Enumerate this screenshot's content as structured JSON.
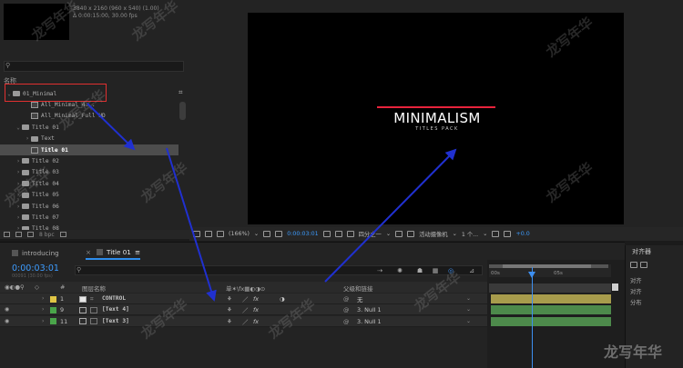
{
  "project": {
    "meta": [
      "3840 x 2160  (960 x 540) (1.00)",
      "Δ 0:00:15:00, 30.00 fps"
    ],
    "name_header": "名称",
    "tree": [
      {
        "label": "01_Minimal",
        "depth": 0,
        "type": "folder",
        "expanded": true
      },
      {
        "label": "All_Minimal_4...",
        "depth": 2,
        "type": "comp"
      },
      {
        "label": "All_Minimal_Full HD",
        "depth": 2,
        "type": "comp"
      },
      {
        "label": "Title 01",
        "depth": 1,
        "type": "folder",
        "expanded": true
      },
      {
        "label": "Text",
        "depth": 2,
        "type": "folder",
        "expanded": false
      },
      {
        "label": "Title 01",
        "depth": 2,
        "type": "comp",
        "selected": true
      },
      {
        "label": "Title 02",
        "depth": 1,
        "type": "folder",
        "expanded": false
      },
      {
        "label": "Title 03",
        "depth": 1,
        "type": "folder",
        "expanded": false
      },
      {
        "label": "Title 04",
        "depth": 1,
        "type": "folder",
        "expanded": false
      },
      {
        "label": "Title 05",
        "depth": 1,
        "type": "folder",
        "expanded": false
      },
      {
        "label": "Title 06",
        "depth": 1,
        "type": "folder",
        "expanded": false
      },
      {
        "label": "Title 07",
        "depth": 1,
        "type": "folder",
        "expanded": false
      },
      {
        "label": "Title 08",
        "depth": 1,
        "type": "folder",
        "expanded": false
      }
    ],
    "footer_bpc": "8 bpc"
  },
  "viewer": {
    "title_main": "MINIMALISM",
    "title_sub": "TITLES PACK",
    "accent_color": "#e8233c",
    "bar": {
      "zoom": "(166%)",
      "time": "0:00:03:01",
      "resolution": "四分之一",
      "camera": "活动摄像机",
      "views": "1 个...",
      "exposure": "+0.0"
    }
  },
  "right_panel": {
    "title": "对齐器",
    "rows": [
      "对齐",
      "对齐",
      "分布"
    ]
  },
  "timeline": {
    "tabs": [
      {
        "label": "introducing"
      },
      {
        "label": "Title 01"
      }
    ],
    "current_time": "0:00:03:01",
    "fps": "00091 (30.00 fps)",
    "columns": {
      "hash": "#",
      "layer_name": "图层名称",
      "switches": "单✶\\fx▦◐◑⊙",
      "parent": "父级和链接"
    },
    "ruler": [
      "00s",
      "05s"
    ],
    "layers": [
      {
        "num": "1",
        "name": "CONTROL",
        "label_color": "#e0c545",
        "parent": "无",
        "bar_color": "#a89c4c",
        "type": "null"
      },
      {
        "num": "9",
        "name": "[Text 4]",
        "label_color": "#4aa54a",
        "parent": "3. Null 1",
        "bar_color": "#4d8a4b",
        "type": "comp"
      },
      {
        "num": "11",
        "name": "[Text 3]",
        "label_color": "#4aa54a",
        "parent": "3. Null 1",
        "bar_color": "#4d8a4b",
        "type": "comp"
      }
    ]
  },
  "watermark": "龙写年华",
  "icons": {
    "search": "search-icon",
    "eye": "eye-icon",
    "expand": "chevron-right-icon",
    "pickwhip": "pickwhip-icon",
    "dropdown": "chevron-down-icon"
  }
}
